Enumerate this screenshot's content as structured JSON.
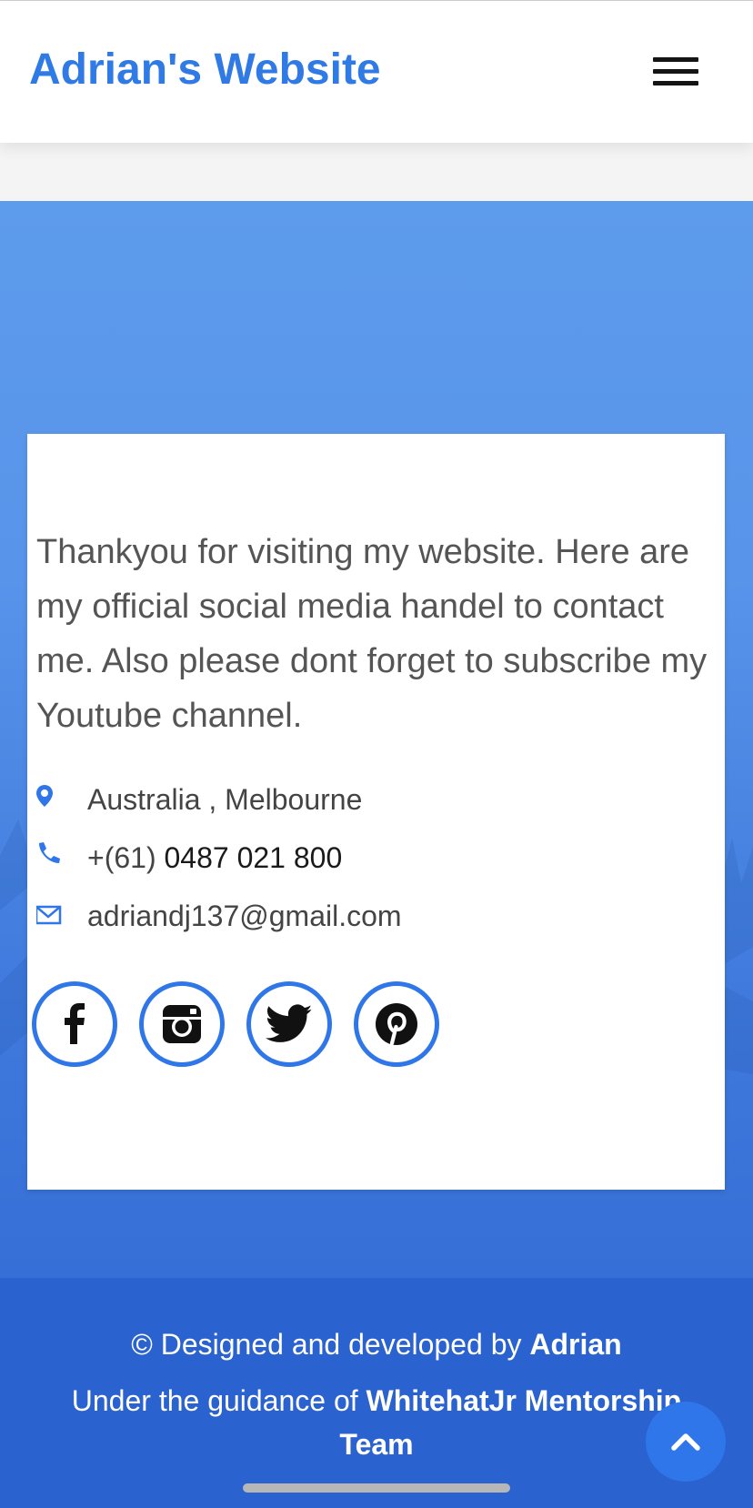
{
  "header": {
    "brand": "Adrian's Website",
    "menu_icon": "hamburger-menu-icon"
  },
  "contact": {
    "message": "Thankyou for visiting my website. Here are my official social media handel to contact me. Also please dont forget to subscribe my Youtube channel.",
    "location": "Australia , Melbourne",
    "phone_code": "+(61)",
    "phone_number": "0487 021 800",
    "email": "adriandj137@gmail.com",
    "icons": [
      "map-pin-icon",
      "phone-icon",
      "envelope-icon"
    ],
    "social": [
      "facebook-icon",
      "instagram-icon",
      "twitter-icon",
      "pinterest-icon"
    ]
  },
  "footer": {
    "copyright_prefix": "© Designed and developed by ",
    "author": "Adrian",
    "guidance_prefix": "Under the guidance of ",
    "team": "WhitehatJr Mentorship Team"
  },
  "scroll_top_icon": "chevron-up-icon",
  "colors": {
    "accent": "#2f7ae5",
    "section_top": "#5d9bec",
    "section_bottom": "#3670d7",
    "footer": "#2a62cf"
  }
}
